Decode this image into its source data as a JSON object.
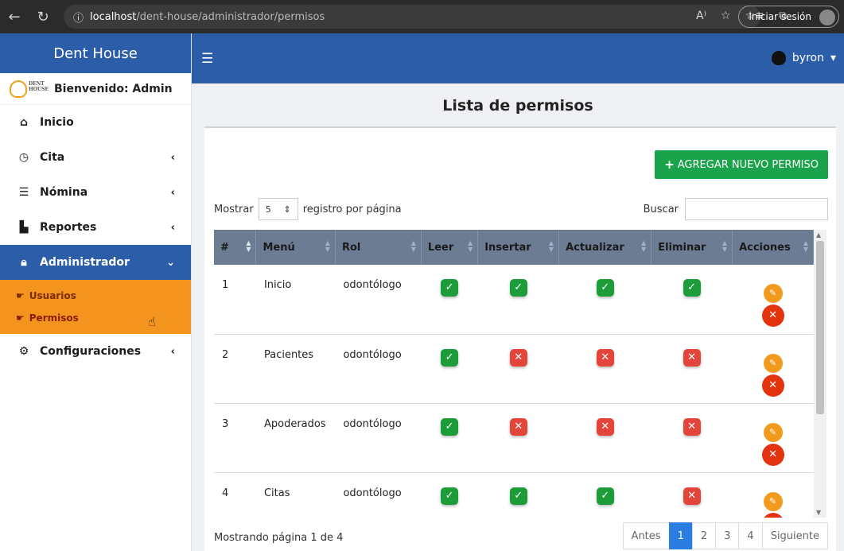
{
  "browser": {
    "host": "localhost",
    "path": "/dent-house/administrador/permisos",
    "login_label": "Iniciar sesión"
  },
  "sidebar": {
    "brand": "Dent House",
    "welcome": "Bienvenido: Admin",
    "logo_text": "DENT HOUSE",
    "items": [
      {
        "label": "Inicio",
        "icon": "home-icon"
      },
      {
        "label": "Cita",
        "icon": "clock-icon"
      },
      {
        "label": "Nómina",
        "icon": "list-icon"
      },
      {
        "label": "Reportes",
        "icon": "file-icon"
      },
      {
        "label": "Administrador",
        "icon": "lock-icon"
      },
      {
        "label": "Configuraciones",
        "icon": "gears-icon"
      }
    ],
    "submenu": [
      {
        "label": "Usuarios"
      },
      {
        "label": "Permisos"
      }
    ]
  },
  "topbar": {
    "user": "byron"
  },
  "main": {
    "title": "Lista de permisos",
    "add_button": "AGREGAR NUEVO PERMISO",
    "show_label": "Mostrar",
    "page_size": "5",
    "per_page_label": "registro por página",
    "search_label": "Buscar",
    "columns": [
      "#",
      "Menú",
      "Rol",
      "Leer",
      "Insertar",
      "Actualizar",
      "Eliminar",
      "Acciones"
    ],
    "rows": [
      {
        "n": "1",
        "menu": "Inicio",
        "rol": "odontólogo",
        "leer": true,
        "insertar": true,
        "actualizar": true,
        "eliminar": true
      },
      {
        "n": "2",
        "menu": "Pacientes",
        "rol": "odontólogo",
        "leer": true,
        "insertar": false,
        "actualizar": false,
        "eliminar": false
      },
      {
        "n": "3",
        "menu": "Apoderados",
        "rol": "odontólogo",
        "leer": true,
        "insertar": false,
        "actualizar": false,
        "eliminar": false
      },
      {
        "n": "4",
        "menu": "Citas",
        "rol": "odontólogo",
        "leer": true,
        "insertar": true,
        "actualizar": true,
        "eliminar": false
      }
    ],
    "info": "Mostrando página 1 de 4",
    "pagination": {
      "prev": "Antes",
      "pages": [
        "1",
        "2",
        "3",
        "4"
      ],
      "current": "1",
      "next": "Siguiente"
    }
  },
  "colors": {
    "primary": "#2c5da8",
    "accent": "#f2941e",
    "success": "#1d9c3a",
    "danger": "#e4453a"
  }
}
